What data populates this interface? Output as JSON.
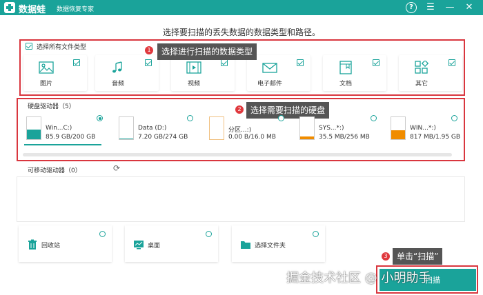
{
  "titlebar": {
    "app_name": "数据蛙",
    "subtitle": "数据恢复专家",
    "help": "?",
    "menu": "☰",
    "minimize": "—",
    "close": "✕"
  },
  "heading": "选择要扫描的丢失数据的数据类型和路径。",
  "select_all": "选择所有文件类型",
  "file_types": [
    {
      "label": "图片",
      "icon": "image-icon"
    },
    {
      "label": "音频",
      "icon": "music-icon"
    },
    {
      "label": "视频",
      "icon": "video-icon"
    },
    {
      "label": "电子邮件",
      "icon": "mail-icon"
    },
    {
      "label": "文档",
      "icon": "document-icon"
    },
    {
      "label": "其它",
      "icon": "other-icon"
    }
  ],
  "callouts": {
    "step1_num": "1",
    "step1": "选择进行扫描的数据类型",
    "step2_num": "2",
    "step2": "选择需要扫描的硬盘",
    "step3_num": "3",
    "step3": "单击“扫描”"
  },
  "hard_drives_label": "硬盘驱动器（5）",
  "drives": [
    {
      "name": "Win...C:)",
      "size": "85.9 GB/200 GB",
      "fill": 0.43,
      "color": "#1aa39a",
      "selected": true
    },
    {
      "name": "Data (D:)",
      "size": "7.20 GB/274 GB",
      "fill": 0.03,
      "color": "#1aa39a",
      "selected": false
    },
    {
      "name": "分区...:)",
      "size": "0.00  B/16.0 MB",
      "fill": 0.0,
      "color": "#f0a030",
      "selected": false
    },
    {
      "name": "SYS...*:)",
      "size": "35.5 MB/256 MB",
      "fill": 0.14,
      "color": "#f08c00",
      "selected": false
    },
    {
      "name": "WIN...*:)",
      "size": "817 MB/1.95 GB",
      "fill": 0.42,
      "color": "#f08c00",
      "selected": false
    }
  ],
  "removable_label": "可移动驱动器（0）",
  "locations": [
    {
      "label": "回收站",
      "icon": "trash-icon"
    },
    {
      "label": "桌面",
      "icon": "desktop-icon"
    },
    {
      "label": "选择文件夹",
      "icon": "folder-icon"
    }
  ],
  "watermark": "掘金技术社区 @ 小明助手",
  "scan_label": "扫描",
  "colors": {
    "accent": "#1aa39a",
    "annotation": "#d9363e"
  }
}
